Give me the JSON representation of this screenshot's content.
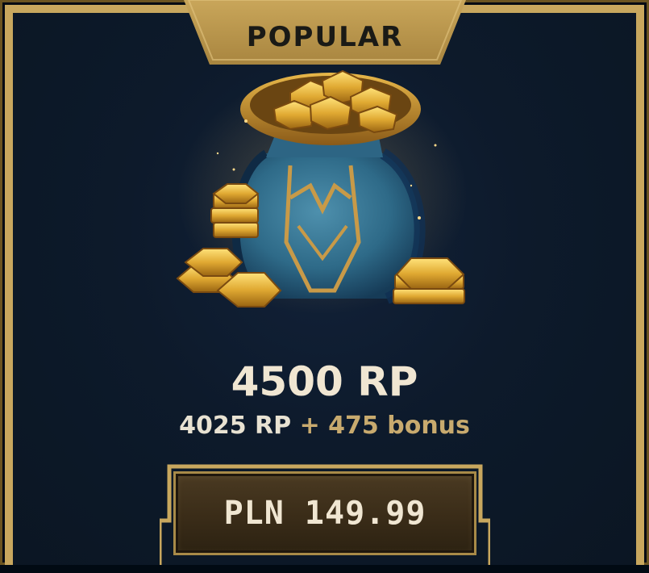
{
  "badge": {
    "label": "POPULAR"
  },
  "offer": {
    "title": "4500 RP",
    "base_amount": "4025 RP",
    "plus": "+",
    "bonus": "475 bonus",
    "price_label": "PLN 149.99"
  },
  "icons": {
    "bag": "rp-bag-icon"
  },
  "colors": {
    "gold": "#c8a75e",
    "panel_bg": "#0d1b2a",
    "title_text": "#f0e6d2",
    "bonus_text": "#c8aa6e"
  }
}
